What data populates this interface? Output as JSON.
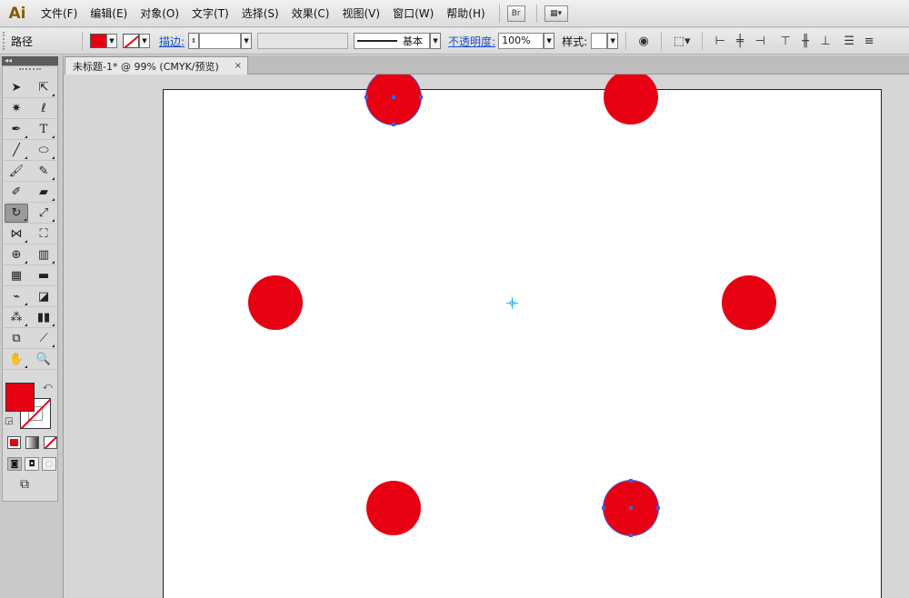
{
  "app": {
    "logo": "Ai"
  },
  "menu": [
    "文件(F)",
    "编辑(E)",
    "对象(O)",
    "文字(T)",
    "选择(S)",
    "效果(C)",
    "视图(V)",
    "窗口(W)",
    "帮助(H)"
  ],
  "menu_buttons": {
    "bridge": "Br"
  },
  "control_bar": {
    "selection_type": "路径",
    "stroke_label": "描边:",
    "stroke_weight": "",
    "stroke_profile": "基本",
    "opacity_label": "不透明度:",
    "opacity_value": "100%",
    "style_label": "样式:"
  },
  "document": {
    "tab_title": "未标题-1* @ 99% (CMYK/预览)",
    "close": "×"
  },
  "toolbox": {
    "collapse": "◂◂"
  },
  "colors": {
    "fill": "#e60012",
    "stroke": "none",
    "selection": "#4a5fd6",
    "artboard": "#ffffff"
  },
  "artwork": {
    "shape": "circle",
    "count": 6,
    "selected_count": 2
  }
}
